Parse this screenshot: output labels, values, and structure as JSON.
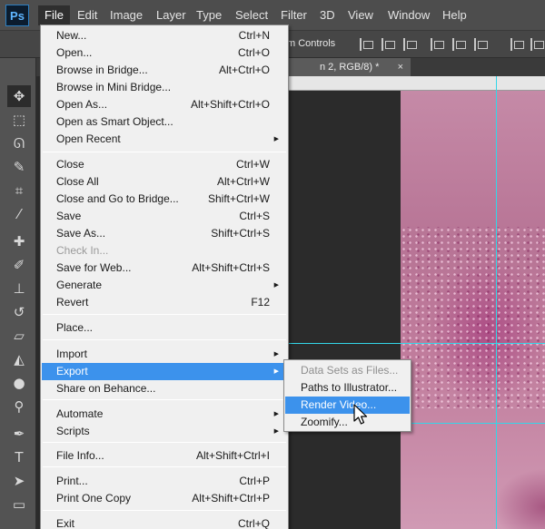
{
  "app": {
    "logo": "Ps"
  },
  "menubar": {
    "items": [
      {
        "label": "File",
        "active": true
      },
      {
        "label": "Edit"
      },
      {
        "label": "Image"
      },
      {
        "label": "Layer"
      },
      {
        "label": "Type"
      },
      {
        "label": "Select"
      },
      {
        "label": "Filter"
      },
      {
        "label": "3D"
      },
      {
        "label": "View"
      },
      {
        "label": "Window"
      },
      {
        "label": "Help"
      }
    ]
  },
  "options_bar": {
    "visible_text": "m Controls"
  },
  "document": {
    "tab_label": "n 2, RGB/8) *",
    "close_glyph": "×"
  },
  "file_menu": {
    "groups": [
      [
        {
          "label": "New...",
          "shortcut": "Ctrl+N"
        },
        {
          "label": "Open...",
          "shortcut": "Ctrl+O"
        },
        {
          "label": "Browse in Bridge...",
          "shortcut": "Alt+Ctrl+O"
        },
        {
          "label": "Browse in Mini Bridge...",
          "shortcut": ""
        },
        {
          "label": "Open As...",
          "shortcut": "Alt+Shift+Ctrl+O"
        },
        {
          "label": "Open as Smart Object...",
          "shortcut": ""
        },
        {
          "label": "Open Recent",
          "shortcut": "",
          "submenu": true
        }
      ],
      [
        {
          "label": "Close",
          "shortcut": "Ctrl+W"
        },
        {
          "label": "Close All",
          "shortcut": "Alt+Ctrl+W"
        },
        {
          "label": "Close and Go to Bridge...",
          "shortcut": "Shift+Ctrl+W"
        },
        {
          "label": "Save",
          "shortcut": "Ctrl+S"
        },
        {
          "label": "Save As...",
          "shortcut": "Shift+Ctrl+S"
        },
        {
          "label": "Check In...",
          "shortcut": "",
          "disabled": true
        },
        {
          "label": "Save for Web...",
          "shortcut": "Alt+Shift+Ctrl+S"
        },
        {
          "label": "Generate",
          "shortcut": "",
          "submenu": true
        },
        {
          "label": "Revert",
          "shortcut": "F12"
        }
      ],
      [
        {
          "label": "Place...",
          "shortcut": ""
        }
      ],
      [
        {
          "label": "Import",
          "shortcut": "",
          "submenu": true
        },
        {
          "label": "Export",
          "shortcut": "",
          "submenu": true,
          "highlight": true
        },
        {
          "label": "Share on Behance...",
          "shortcut": ""
        }
      ],
      [
        {
          "label": "Automate",
          "shortcut": "",
          "submenu": true
        },
        {
          "label": "Scripts",
          "shortcut": "",
          "submenu": true
        }
      ],
      [
        {
          "label": "File Info...",
          "shortcut": "Alt+Shift+Ctrl+I"
        }
      ],
      [
        {
          "label": "Print...",
          "shortcut": "Ctrl+P"
        },
        {
          "label": "Print One Copy",
          "shortcut": "Alt+Shift+Ctrl+P"
        }
      ],
      [
        {
          "label": "Exit",
          "shortcut": "Ctrl+Q"
        }
      ]
    ]
  },
  "export_submenu": {
    "items": [
      {
        "label": "Data Sets as Files...",
        "disabled": true
      },
      {
        "label": "Paths to Illustrator..."
      },
      {
        "label": "Render Video...",
        "highlight": true
      },
      {
        "label": "Zoomify..."
      }
    ]
  },
  "tools": [
    "move-icon",
    "marquee-icon",
    "lasso-icon",
    "quick-select-icon",
    "crop-icon",
    "eyedropper-icon",
    "healing-brush-icon",
    "brush-icon",
    "clone-stamp-icon",
    "history-brush-icon",
    "eraser-icon",
    "paint-bucket-icon",
    "blur-icon",
    "dodge-icon",
    "pen-icon",
    "type-icon",
    "path-select-icon",
    "shape-icon",
    "hand-icon",
    "zoom-icon"
  ],
  "colors": {
    "menu_highlight": "#3c92ec",
    "guide": "#33d6e8",
    "menubar_bg": "#4d4d4d"
  }
}
